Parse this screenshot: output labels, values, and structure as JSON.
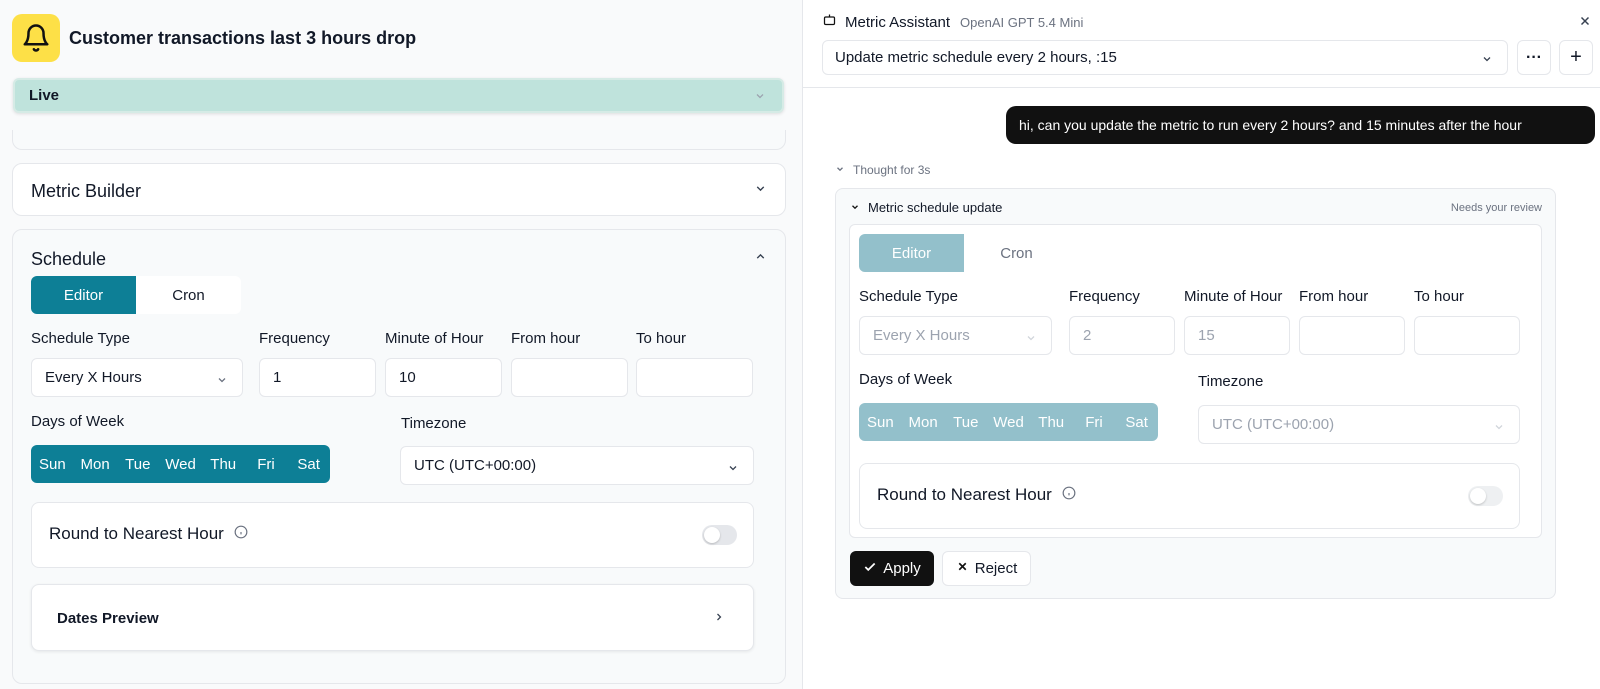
{
  "left": {
    "title": "Customer transactions last 3 hours drop",
    "status": {
      "label": "Live"
    },
    "metric_builder": {
      "label": "Metric Builder"
    },
    "schedule": {
      "label": "Schedule",
      "modes": [
        "Editor",
        "Cron"
      ],
      "active_mode": "Editor",
      "schedule_type": {
        "label": "Schedule Type",
        "value": "Every X Hours"
      },
      "frequency": {
        "label": "Frequency",
        "value": "1"
      },
      "minute_of_hour": {
        "label": "Minute of Hour",
        "value": "10"
      },
      "from_hour": {
        "label": "From hour",
        "value": ""
      },
      "to_hour": {
        "label": "To hour",
        "value": ""
      },
      "days_of_week": {
        "label": "Days of Week",
        "days": [
          "Sun",
          "Mon",
          "Tue",
          "Wed",
          "Thu",
          "Fri",
          "Sat"
        ]
      },
      "timezone": {
        "label": "Timezone",
        "value": "UTC (UTC+00:00)"
      },
      "round_to_nearest_hour": {
        "label": "Round to Nearest Hour",
        "enabled": false
      },
      "dates_preview": {
        "label": "Dates Preview"
      }
    }
  },
  "assistant": {
    "name": "Metric Assistant",
    "model": "OpenAI GPT 5.4 Mini",
    "conversation": "Update metric schedule every 2 hours, :15",
    "more_label": "···",
    "new_label": "+",
    "user_message": "hi, can you update the metric to run every 2 hours? and 15 minutes after the hour",
    "thought": "Thought for 3s",
    "proposal": {
      "title": "Metric schedule update",
      "status": "Needs your review",
      "modes": [
        "Editor",
        "Cron"
      ],
      "active_mode": "Editor",
      "schedule_type": {
        "label": "Schedule Type",
        "value": "Every X Hours"
      },
      "frequency": {
        "label": "Frequency",
        "value": "2"
      },
      "minute_of_hour": {
        "label": "Minute of Hour",
        "value": "15"
      },
      "from_hour": {
        "label": "From hour",
        "value": ""
      },
      "to_hour": {
        "label": "To hour",
        "value": ""
      },
      "days_of_week": {
        "label": "Days of Week",
        "days": [
          "Sun",
          "Mon",
          "Tue",
          "Wed",
          "Thu",
          "Fri",
          "Sat"
        ]
      },
      "timezone": {
        "label": "Timezone",
        "value": "UTC (UTC+00:00)"
      },
      "round_to_nearest_hour": {
        "label": "Round to Nearest Hour",
        "enabled": false
      },
      "apply_label": "Apply",
      "reject_label": "Reject"
    }
  },
  "colors": {
    "accent": "#0d7f96",
    "accent_muted": "#93c0cb",
    "live_bg": "#bfe3dc",
    "bell_bg": "#fde047"
  },
  "icons": [
    "bell-icon",
    "chevron-down-icon",
    "chevron-up-icon",
    "chevron-right-icon",
    "info-icon",
    "bot-icon",
    "close-icon",
    "check-icon",
    "x-icon"
  ]
}
